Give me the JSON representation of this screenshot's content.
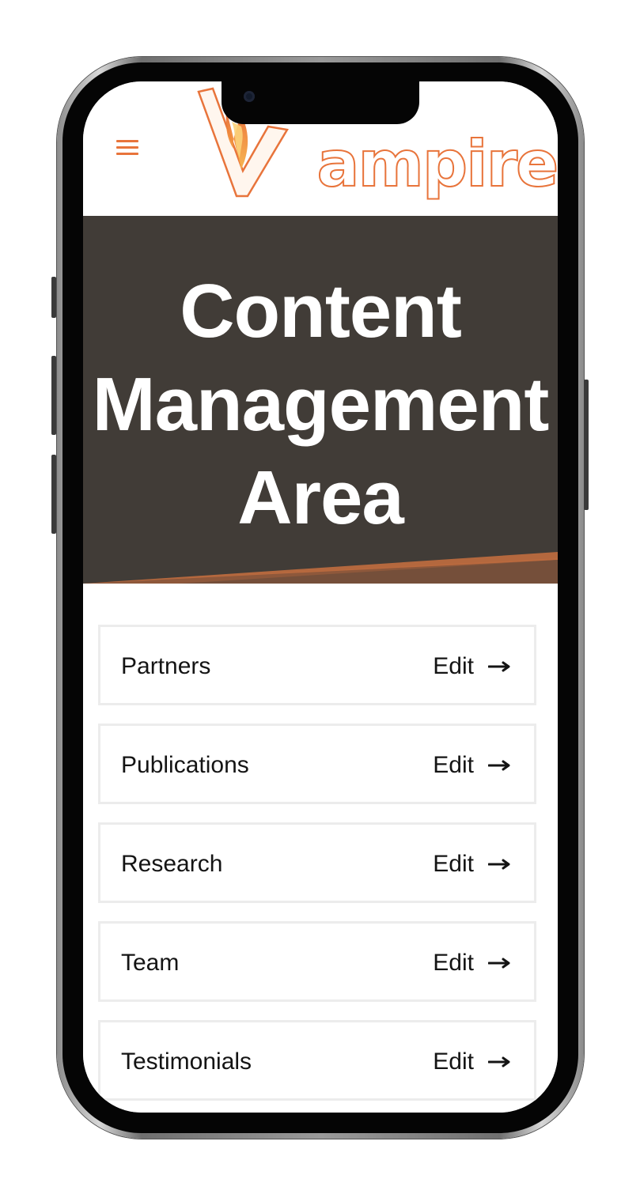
{
  "brand": {
    "logo_text": "Vampire",
    "accent_color": "#e8743b"
  },
  "header": {
    "menu_icon": "hamburger-menu-icon"
  },
  "hero": {
    "title": "Content Management Area",
    "background_color": "#413c37"
  },
  "items": [
    {
      "label": "Partners",
      "action": "Edit",
      "icon": "arrow-right-icon"
    },
    {
      "label": "Publications",
      "action": "Edit",
      "icon": "arrow-right-icon"
    },
    {
      "label": "Research",
      "action": "Edit",
      "icon": "arrow-right-icon"
    },
    {
      "label": "Team",
      "action": "Edit",
      "icon": "arrow-right-icon"
    },
    {
      "label": "Testimonials",
      "action": "Edit",
      "icon": "arrow-right-icon"
    }
  ]
}
